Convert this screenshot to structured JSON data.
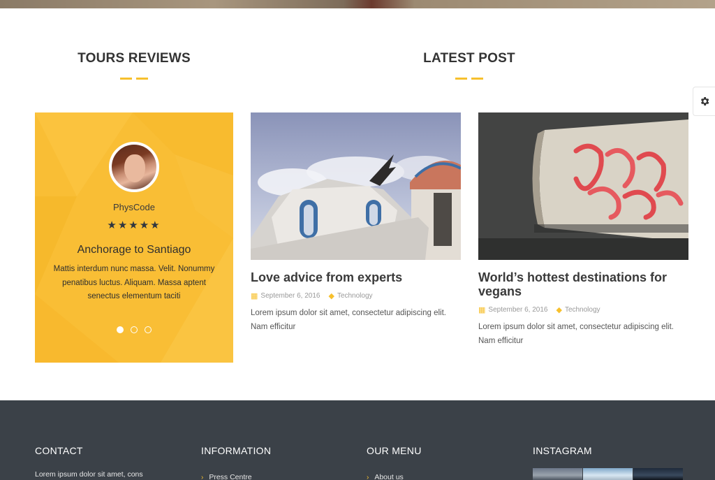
{
  "sections": {
    "reviews_title": "TOURS REVIEWS",
    "latest_title": "LATEST POST"
  },
  "review": {
    "name": "PhysCode",
    "stars": "★★★★★",
    "rating": 5,
    "title": "Anchorage to Santiago",
    "text": "Mattis interdum nunc massa. Velit. Nonummy penatibus luctus. Aliquam. Massa aptent senectus elementum taciti",
    "slides_total": 3,
    "slide_active": 1
  },
  "posts": [
    {
      "title": "Love advice from experts",
      "date": "September 6, 2016",
      "category": "Technology",
      "excerpt": "Lorem ipsum dolor sit amet, consectetur adipiscing elit. Nam efficitur"
    },
    {
      "title": "World’s hottest destinations for vegans",
      "date": "September 6, 2016",
      "category": "Technology",
      "excerpt": "Lorem ipsum dolor sit amet, consectetur adipiscing elit. Nam efficitur"
    }
  ],
  "footer": {
    "contact": {
      "heading": "CONTACT",
      "text": "Lorem ipsum dolor sit amet, cons"
    },
    "information": {
      "heading": "INFORMATION",
      "first_link": "Press Centre"
    },
    "our_menu": {
      "heading": "OUR MENU",
      "first_link": "About us"
    },
    "instagram": {
      "heading": "INSTAGRAM"
    }
  },
  "colors": {
    "accent": "#f7c02d",
    "review_card": "#f9be35",
    "footer_bg": "#3b4148"
  },
  "icons": {
    "settings": "gear-icon",
    "date": "calendar-icon",
    "category": "tag-icon",
    "link_bullet": "chevron-right-icon"
  }
}
